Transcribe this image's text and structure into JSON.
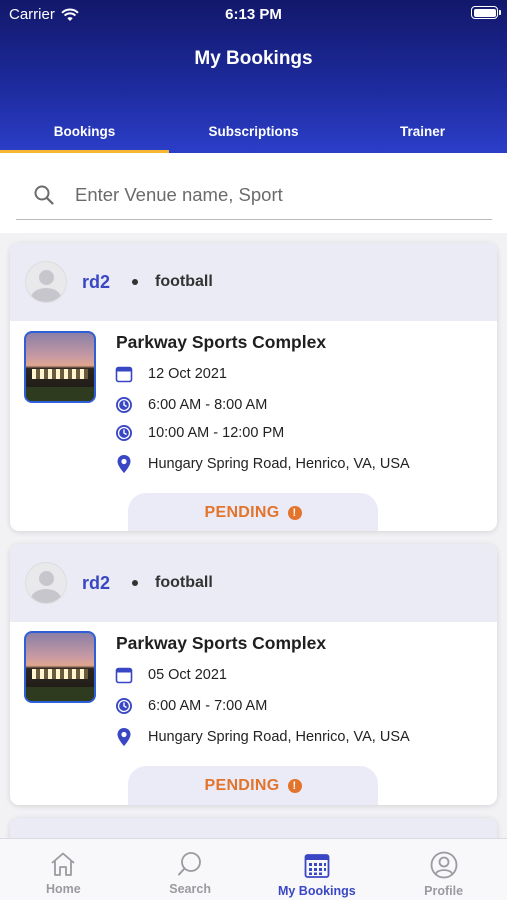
{
  "status_bar": {
    "carrier": "Carrier",
    "time": "6:13 PM"
  },
  "header": {
    "title": "My Bookings"
  },
  "tabs": [
    {
      "label": "Bookings",
      "active": true
    },
    {
      "label": "Subscriptions",
      "active": false
    },
    {
      "label": "Trainer",
      "active": false
    }
  ],
  "search": {
    "placeholder": "Enter Venue name, Sport",
    "value": ""
  },
  "bookings": [
    {
      "user": "rd2",
      "sport": "football",
      "venue": "Parkway Sports Complex",
      "date": "12 Oct 2021",
      "slots": [
        "6:00 AM - 8:00 AM",
        "10:00 AM - 12:00 PM"
      ],
      "address": "Hungary Spring Road, Henrico, VA, USA",
      "status": "PENDING"
    },
    {
      "user": "rd2",
      "sport": "football",
      "venue": "Parkway Sports Complex",
      "date": "05 Oct 2021",
      "slots": [
        "6:00 AM - 7:00 AM"
      ],
      "address": "Hungary Spring Road, Henrico, VA, USA",
      "status": "PENDING"
    }
  ],
  "bottom_nav": [
    {
      "label": "Home",
      "icon": "home-icon",
      "active": false
    },
    {
      "label": "Search",
      "icon": "search-icon",
      "active": false
    },
    {
      "label": "My Bookings",
      "icon": "calendar-icon",
      "active": true
    },
    {
      "label": "Profile",
      "icon": "profile-icon",
      "active": false
    }
  ],
  "colors": {
    "header_dark": "#12186a",
    "header_light": "#2b3ec8",
    "tab_indicator": "#f5b731",
    "accent": "#3a47c4",
    "pending": "#e2742c",
    "card_header": "#ebebf6"
  }
}
